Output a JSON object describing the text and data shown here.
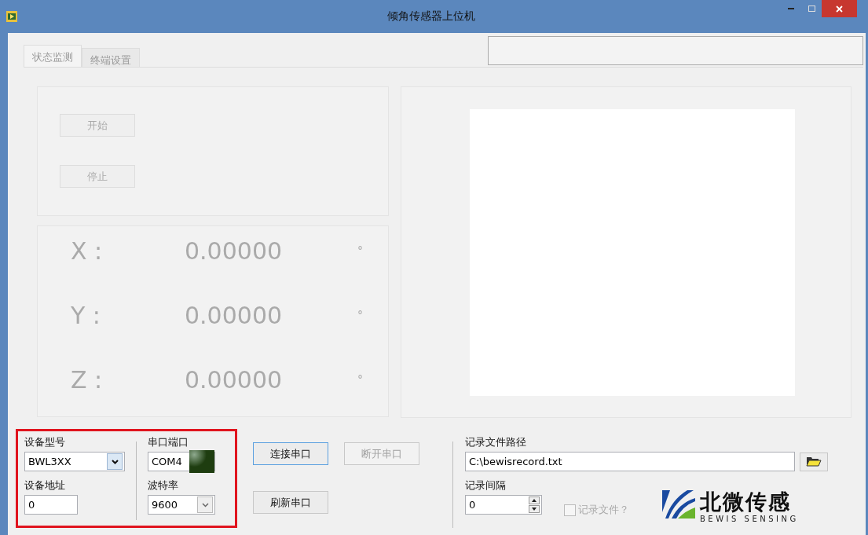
{
  "window": {
    "title": "倾角传感器上位机"
  },
  "tabs": [
    {
      "label": "状态监测",
      "selected": true
    },
    {
      "label": "终端设置",
      "selected": false
    }
  ],
  "controls": [
    {
      "label": "开始",
      "disabled": true
    },
    {
      "label": "停止",
      "disabled": true
    }
  ],
  "readings": [
    {
      "axis": "X :",
      "value": "0.00000",
      "unit": "°"
    },
    {
      "axis": "Y :",
      "value": "0.00000",
      "unit": "°"
    },
    {
      "axis": "Z :",
      "value": "0.00000",
      "unit": "°"
    }
  ],
  "device": {
    "model_label": "设备型号",
    "model": "BWL3XX",
    "address_label": "设备地址",
    "address": "0"
  },
  "serial": {
    "port_label": "串口端口",
    "port": "COM4",
    "indicator_on": false,
    "baud_label": "波特率",
    "baud": "9600"
  },
  "serial_buttons": [
    {
      "label": "连接串口",
      "disabled": false,
      "focused": true
    },
    {
      "label": "断开串口",
      "disabled": true,
      "focused": false
    },
    {
      "label": "刷新串口",
      "disabled": false,
      "focused": false
    }
  ],
  "record": {
    "path_label": "记录文件路径",
    "path": "C:\\bewisrecord.txt",
    "interval_label": "记录间隔",
    "interval": "0",
    "file_checkbox": {
      "label": "记录文件？",
      "checked": false,
      "disabled": true
    }
  },
  "logo": {
    "name": "北微传感",
    "subtitle": "BEWIS SENSING"
  }
}
